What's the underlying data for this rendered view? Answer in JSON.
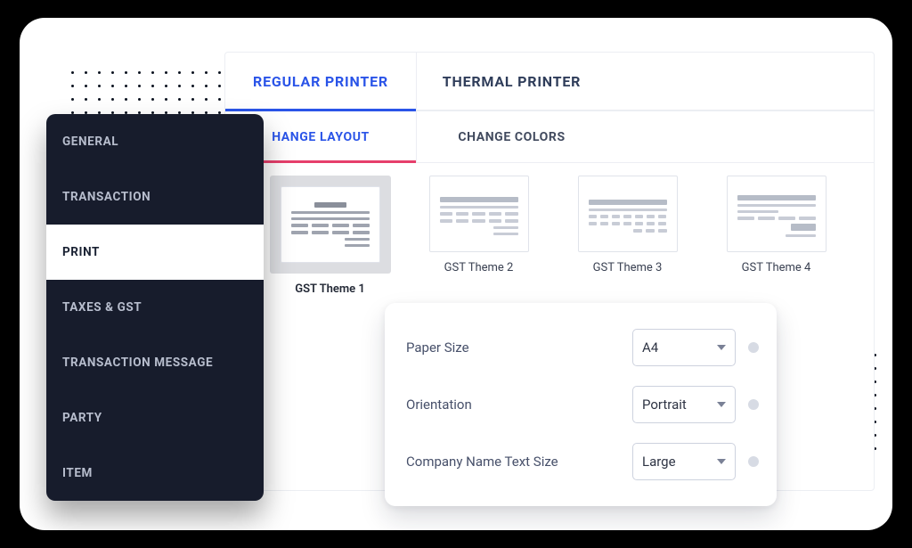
{
  "tabs": {
    "printer": [
      {
        "label": "REGULAR PRINTER",
        "active": true
      },
      {
        "label": "THERMAL PRINTER",
        "active": false
      }
    ],
    "sub": [
      {
        "label": "CHANGE LAYOUT",
        "visible_label": "HANGE LAYOUT",
        "active": true
      },
      {
        "label": "CHANGE COLORS",
        "active": false
      }
    ]
  },
  "themes": [
    {
      "label": "GST Theme 1",
      "selected": true
    },
    {
      "label": "GST Theme 2",
      "selected": false
    },
    {
      "label": "GST Theme 3",
      "selected": false
    },
    {
      "label": "GST Theme 4",
      "selected": false
    }
  ],
  "sidebar": [
    {
      "label": "GENERAL",
      "active": false
    },
    {
      "label": "TRANSACTION",
      "active": false
    },
    {
      "label": "PRINT",
      "active": true
    },
    {
      "label": "TAXES & GST",
      "active": false
    },
    {
      "label": "TRANSACTION MESSAGE",
      "active": false
    },
    {
      "label": "PARTY",
      "active": false
    },
    {
      "label": "ITEM",
      "active": false
    }
  ],
  "settings": {
    "paper_size": {
      "label": "Paper Size",
      "value": "A4"
    },
    "orientation": {
      "label": "Orientation",
      "value": "Portrait"
    },
    "company_name_text_size": {
      "label": "Company Name Text Size",
      "value": "Large"
    }
  },
  "colors": {
    "accent_blue": "#2a54e8",
    "accent_underline": "#e63f6b",
    "sidebar_bg": "#171c2c"
  }
}
